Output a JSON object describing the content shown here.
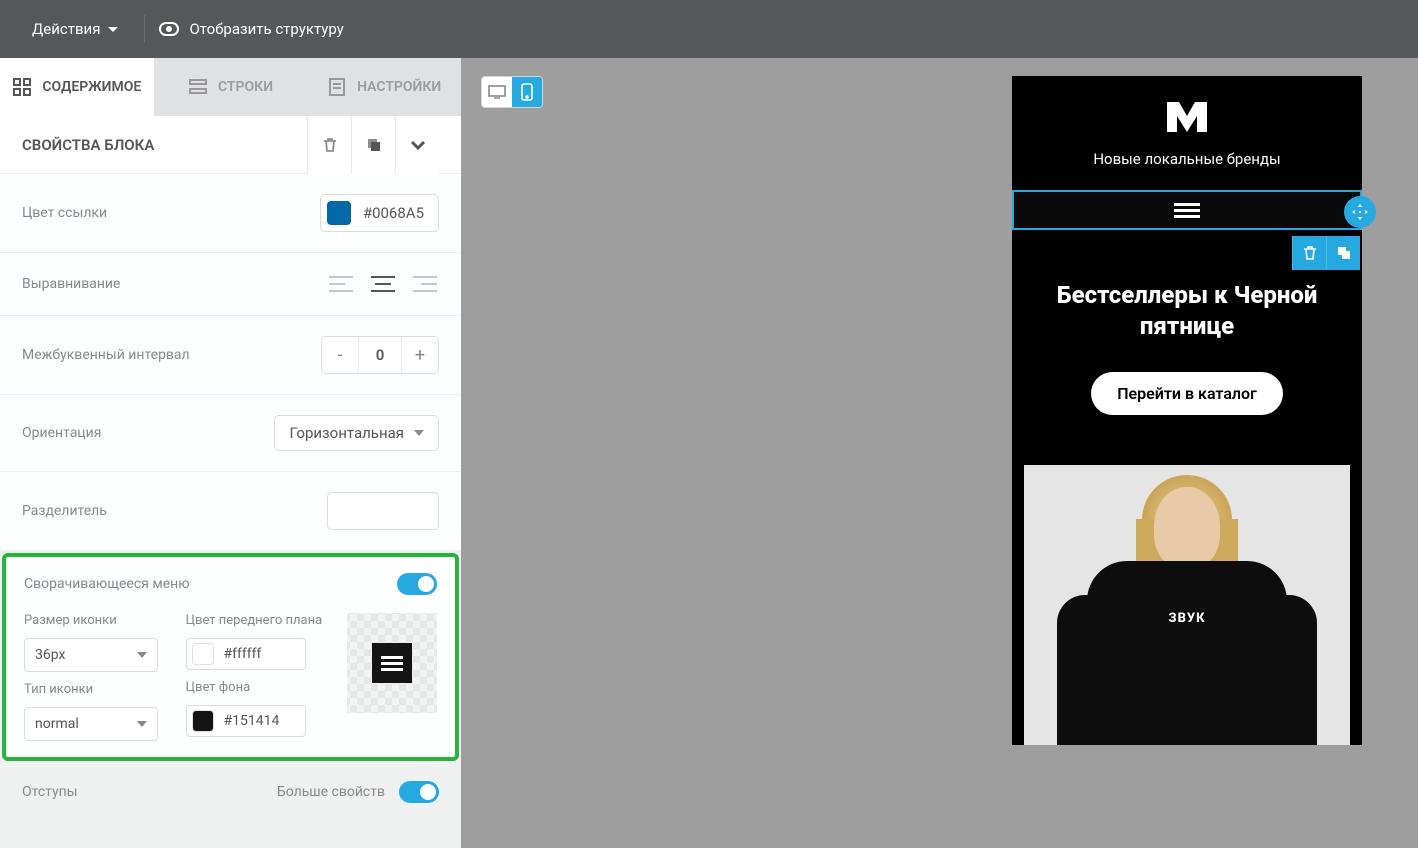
{
  "toolbar": {
    "actions": "Действия",
    "show_structure": "Отобразить структуру"
  },
  "tabs": {
    "content": "СОДЕРЖИМОЕ",
    "rows": "СТРОКИ",
    "settings": "НАСТРОЙКИ"
  },
  "block_header": {
    "title": "СВОЙСТВА БЛОКА"
  },
  "props": {
    "link_color": {
      "label": "Цвет ссылки",
      "value": "#0068A5",
      "swatch": "#0068A5"
    },
    "align": {
      "label": "Выравнивание"
    },
    "letter_spacing": {
      "label": "Межбуквенный интервал",
      "value": "0"
    },
    "orientation": {
      "label": "Ориентация",
      "value": "Горизонтальная"
    },
    "divider": {
      "label": "Разделитель",
      "value": ""
    },
    "hamburger": {
      "label": "Сворачивающееся меню",
      "on": true,
      "icon_size": {
        "label": "Размер иконки",
        "value": "36px"
      },
      "fg": {
        "label": "Цвет переднего плана",
        "value": "#ffffff",
        "swatch": "#ffffff"
      },
      "icon_type": {
        "label": "Тип иконки",
        "value": "normal"
      },
      "bg": {
        "label": "Цвет фона",
        "value": "#151414",
        "swatch": "#151414"
      }
    },
    "padding": {
      "label": "Отступы",
      "more": "Больше свойств",
      "on": true
    }
  },
  "preview": {
    "tagline": "Новые локальные бренды",
    "hero_title": "Бестселлеры к Черной пятнице",
    "cta": "Перейти в каталог",
    "shirt": "ЗВУК"
  }
}
